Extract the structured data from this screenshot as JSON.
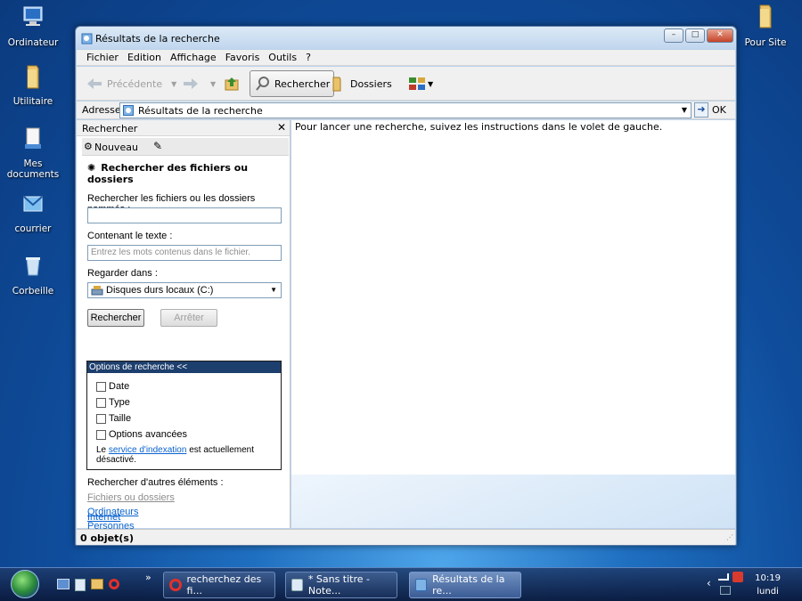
{
  "desktop": {
    "icons": [
      {
        "label": "Ordinateur",
        "icon": "computer-icon"
      },
      {
        "label": "Utilitaire",
        "icon": "folder-icon"
      },
      {
        "label": "Mes documents",
        "icon": "documents-icon"
      },
      {
        "label": "courrier",
        "icon": "mail-icon"
      },
      {
        "label": "Corbeille",
        "icon": "recycle-bin-icon"
      },
      {
        "label": "Pour Site",
        "icon": "folder-icon"
      }
    ]
  },
  "window": {
    "title": "Résultats de la recherche",
    "menu": [
      "Fichier",
      "Edition",
      "Affichage",
      "Favoris",
      "Outils",
      "?"
    ],
    "toolbar": {
      "back": "Précédente",
      "search": "Rechercher",
      "folders": "Dossiers"
    },
    "address": {
      "label": "Adresse",
      "value": "Résultats de la recherche",
      "go": "OK"
    },
    "pane": {
      "title": "Rechercher",
      "new_label": "Nouveau",
      "heading": "Rechercher des fichiers ou dossiers",
      "named_label": "Rechercher les fichiers ou les dossiers nommés :",
      "named_value": "",
      "text_label": "Contenant le texte :",
      "text_placeholder": "Entrez les mots contenus dans le fichier.",
      "lookin_label": "Regarder dans :",
      "lookin_value": "Disques durs locaux (C:)",
      "search_button": "Rechercher",
      "stop_button": "Arrêter",
      "options_header": "Options de recherche <<",
      "options": [
        "Date",
        "Type",
        "Taille",
        "Options avancées"
      ],
      "index_prefix": "Le",
      "index_link": "service d'indexation",
      "index_suffix": "est actuellement désactivé.",
      "other_label": "Rechercher d'autres éléments :",
      "other_links": [
        "Fichiers ou dossiers",
        "Ordinateurs",
        "Personnes",
        "Internet"
      ]
    },
    "content_message": "Pour lancer une recherche, suivez les instructions dans le volet de gauche.",
    "status": "0 objet(s)"
  },
  "taskbar": {
    "tasks": [
      "recherchez des fi...",
      "* Sans titre - Note...",
      "Résultats de la re..."
    ],
    "chevron": "»",
    "tray_chevron": "‹",
    "clock_time": "10:19",
    "clock_day": "lundi"
  },
  "colors": {
    "accent": "#1d3f6e",
    "link": "#0b63cf"
  }
}
